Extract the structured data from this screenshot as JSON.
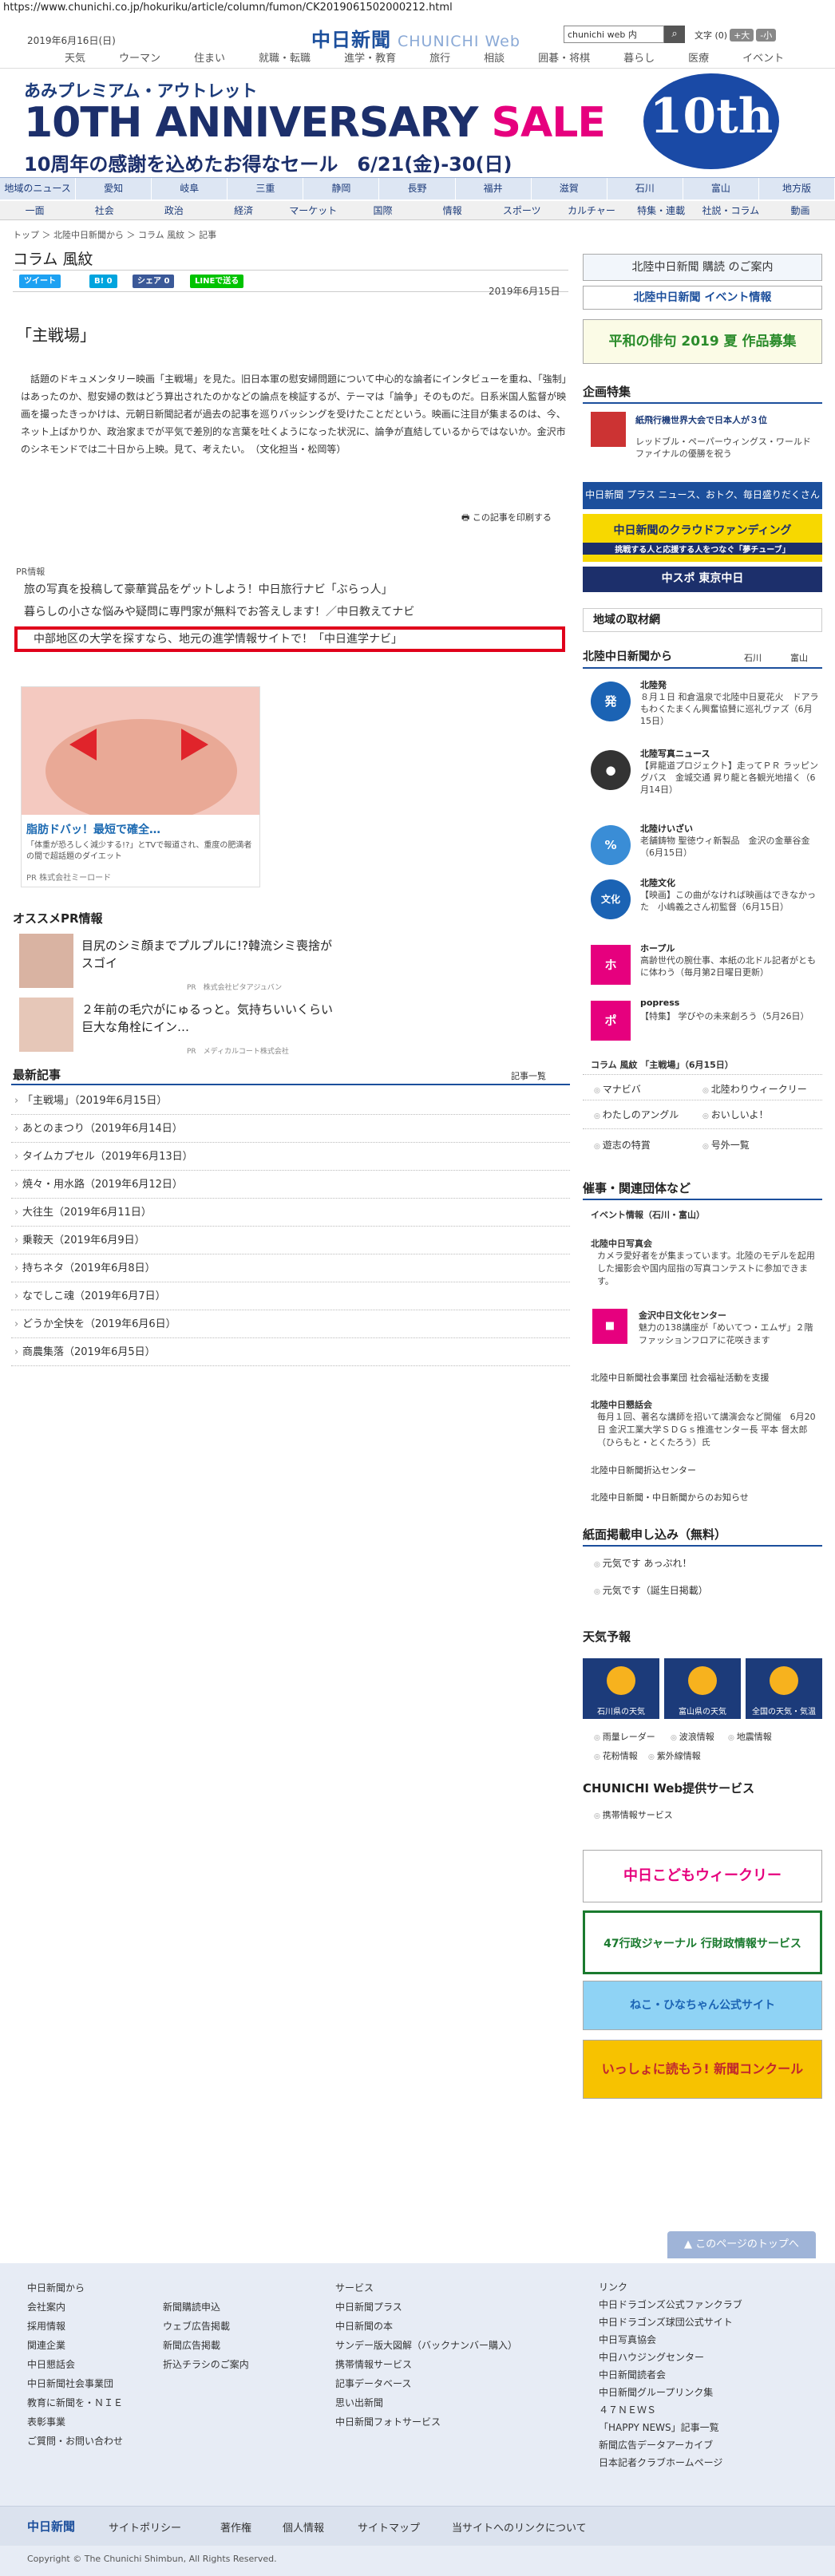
{
  "url": "https://www.chunichi.co.jp/hokuriku/article/column/fumon/CK2019061502000212.html",
  "header": {
    "date": "2019年6月16日(日)",
    "logo": "中日新聞",
    "logo_sub": "CHUNICHI Web",
    "search_placeholder": "chunichi web 内",
    "search_icon": "magnifier-icon",
    "font_label": "文字 (0)",
    "font_plus": "+大",
    "font_minus": "-小"
  },
  "gnav": [
    "天気",
    "ウーマン",
    "住まい",
    "就職・転職",
    "進学・教育",
    "旅行",
    "相談",
    "囲碁・将棋",
    "暮らし",
    "医療",
    "イベント"
  ],
  "ad": {
    "line1": "あみプレミアム・アウトレット",
    "line2a": "10TH ANNIVERSARY ",
    "line2b": "SALE",
    "line3": "10周年の感謝を込めたお得なセール　6/21(金)-30(日)",
    "badge": "10th"
  },
  "regnav": [
    "地域のニュース",
    "愛知",
    "岐阜",
    "三重",
    "静岡",
    "長野",
    "福井",
    "滋賀",
    "石川",
    "富山",
    "地方版"
  ],
  "catnav": [
    "一面",
    "社会",
    "政治",
    "経済",
    "マーケット",
    "国際",
    "情報",
    "スポーツ",
    "カルチャー",
    "特集・連載",
    "社説・コラム",
    "動画"
  ],
  "crumb": "トップ ＞ 北陸中日新聞から ＞ コラム 風紋 ＞ 記事",
  "title": "コラム 風紋",
  "share": {
    "tweet": "ツイート",
    "hatena": "B! 0",
    "fb": "シェア 0",
    "line": "LINEで送る"
  },
  "article_date": "2019年6月15日",
  "headline": "「主戦場」",
  "body": "　話題のドキュメンタリー映画「主戦場」を見た。旧日本軍の慰安婦問題について中心的な論者にインタビューを重ね、「強制」はあったのか、慰安婦の数はどう算出されたのかなどの論点を検証するが、テーマは「論争」そのものだ。日系米国人監督が映画を撮ったきっかけは、元朝日新聞記者が過去の記事を巡りバッシングを受けたことだという。映画に注目が集まるのは、今、ネット上ばかりか、政治家までが平気で差別的な言葉を吐くようになった状況に、論争が直結しているからではないか。金沢市のシネモンドでは二十日から上映。見て、考えたい。　（文化担当・松岡等）",
  "print": "この記事を印刷する",
  "pr_label": "PR情報",
  "pr_links": [
    "旅の写真を投稿して豪華賞品をゲットしよう！中日旅行ナビ「ぶらっ人」",
    "暮らしの小さな悩みや疑問に専門家が無料でお答えします！／中日教えてナビ",
    "中部地区の大学を探すなら、地元の進学情報サイトで！「中日進学ナビ」"
  ],
  "adbox": {
    "title": "脂肪ドバッ！最短で確全…",
    "desc": "「体重が恐ろしく減少する!?」とTVで報道され、重度の肥満者の間で超話題のダイエット",
    "pr": "PR 株式会社ミーロード"
  },
  "osusume": {
    "title": "オススメPR情報",
    "items": [
      {
        "text": "目尻のシミ顔までプルプルに!?韓流シミ喪捨がスゴイ",
        "pr": "PR　株式会社ピタアジュバン"
      },
      {
        "text": "２年前の毛穴がにゅるっと。気持ちいいくらい巨大な角栓にイン…",
        "pr": "PR　メディカルコート株式会社"
      }
    ]
  },
  "latest": {
    "title": "最新記事",
    "all": "記事一覧",
    "items": [
      "「主戦場」（2019年6月15日）",
      "あとのまつり（2019年6月14日）",
      "タイムカプセル（2019年6月13日）",
      "焼々・用水路（2019年6月12日）",
      "大往生（2019年6月11日）",
      "乗鞍天（2019年6月9日）",
      "持ちネタ（2019年6月8日）",
      "なでしこ魂（2019年6月7日）",
      "どうか全快を（2019年6月6日）",
      "商農集落（2019年6月5日）"
    ]
  },
  "sidebar": {
    "subscribe": "北陸中日新聞 購読 のご案内",
    "event": "北陸中日新聞 イベント情報",
    "haiku": "平和の俳句 2019 夏 作品募集",
    "feature_title": "企画特集",
    "feature_item": "紙飛行機世界大会で日本人が３位",
    "feature_sub": "レッドブル・ペーパーウィングス・ワールドファイナルの優勝を祝う",
    "plus": "中日新聞 プラス ニュース、おトク、毎日盛りだくさん",
    "crowd": "中日新聞のクラウドファンディング",
    "crowd_sub": "挑戦する人と応援する人をつなぐ「夢チューブ」",
    "chupo": "中スポ 東京中日",
    "local": "地域の取材網",
    "from_title": "北陸中日新聞から",
    "from_links": [
      "石川",
      "富山"
    ],
    "items": [
      {
        "icon": "発",
        "color": "#1b63b4",
        "h": "北陸発",
        "d": "８月１日 和倉温泉で北陸中日夏花火　ドアラもわくたまくん興奮協賛に巡礼ヴァズ（6月15日）"
      },
      {
        "icon": "●",
        "color": "#333",
        "h": "北陸写真ニュース",
        "d": "【昇龍道プロジェクト】走ってＰＲ ラッピングバス　金城交通 昇り龍と各観光地描く（6月14日）"
      },
      {
        "icon": "%",
        "color": "#3a8dd6",
        "h": "北陸けいざい",
        "d": "老舗鋳物 聖徳ウィ新製品　金沢の金華谷金（6月15日）"
      },
      {
        "icon": "文化",
        "color": "#1b63b4",
        "h": "北陸文化",
        "d": "【映画】この曲がなければ映画はできなかった　小嶋義之さん初監督（6月15日）"
      },
      {
        "icon": "ホ",
        "color": "#e6007e",
        "h": "ホープル",
        "d": "高齢世代の腕仕事、本紙の北ドル記者がともに体わう（毎月第2日曜日更新）"
      },
      {
        "icon": "ポ",
        "color": "#e6007e",
        "h": "popress",
        "d": "【特集】 学びやの未来創ろう（5月26日）"
      }
    ],
    "column": "コラム 風紋 「主戦場」（6月15日）",
    "links2": [
      "マナビバ",
      "北陸わりウィークリー",
      "わたしのアングル",
      "おいしいよ！",
      "遊志の特賞",
      "号外一覧"
    ],
    "events_title": "催事・関連団体など",
    "events_sub": "イベント情報（石川・富山）",
    "ev1_h": "北陸中日写真会",
    "ev1_d": "カメラ愛好者をが集まっています。北陸のモデルを起用した撮影会や国内屈指の写真コンテストに参加できます。",
    "ev2_h": "金沢中日文化センター",
    "ev2_d": "魅力の138講座が「めいてつ・エムザ」２階ファッションフロアに花咲きます",
    "ev3": "北陸中日新聞社会事業団 社会福祉活動を支援",
    "ev4_h": "北陸中日懇話会",
    "ev4_d": "毎月１回、著名な講師を招いて講演会など開催　6月20日 金沢工業大学ＳＤＧｓ推進センター長 平本 督太郎（ひらもと・とくたろう）氏",
    "ev5": "北陸中日新聞折込センター",
    "ev6": "北陸中日新聞・中日新聞からのお知らせ",
    "notice_title": "紙面掲載申し込み（無料）",
    "notice1": "元気です あっぷれ！",
    "notice2": "元気です（誕生日掲載）",
    "weather_title": "天気予報",
    "weather": [
      "石川県の天気",
      "富山県の天気",
      "全国の天気・気温"
    ],
    "weather_links": [
      "雨量レーダー",
      "波浪情報",
      "地震情報",
      "花粉情報",
      "紫外線情報"
    ],
    "service_title": "CHUNICHI Web提供サービス",
    "service1": "携帯情報サービス",
    "ban1": "中日こどもウィークリー",
    "ban2": "47行政ジャーナル 行財政情報サービス",
    "ban3": "ねこ・ひなちゃん公式サイト",
    "ban4": "いっしょに読もう! 新聞コンクール"
  },
  "backtop": "このページのトップへ",
  "footer": {
    "col1": [
      "中日新聞から",
      "会社案内",
      "採用情報",
      "関連企業",
      "中日懇話会",
      "中日新聞社会事業団",
      "教育に新聞を・ＮＩＥ",
      "表彰事業",
      "ご質問・お問い合わせ"
    ],
    "col2": [
      "新聞購読申込",
      "ウェブ広告掲載",
      "新聞広告掲載",
      "折込チラシのご案内"
    ],
    "col3": [
      "サービス",
      "中日新聞プラス",
      "中日新聞の本",
      "サンデー版大図解（バックナンバー購入）",
      "携帯情報サービス",
      "記事データベース",
      "思い出新聞",
      "中日新聞フォトサービス"
    ],
    "col4": [
      "リンク",
      "中日ドラゴンズ公式ファンクラブ",
      "中日ドラゴンズ球団公式サイト",
      "中日写真協会",
      "中日ハウジングセンター",
      "中日新聞読者会",
      "中日新聞グループリンク集",
      "４７ＮＥＷＳ",
      "「HAPPY NEWS」記事一覧",
      "新聞広告データアーカイブ",
      "日本記者クラブホームページ"
    ]
  },
  "fnav": [
    "中日新聞",
    "サイトポリシー",
    "著作権",
    "個人情報",
    "サイトマップ",
    "当サイトへのリンクについて"
  ],
  "copyright": "Copyright © The Chunichi Shimbun, All Rights Reserved."
}
